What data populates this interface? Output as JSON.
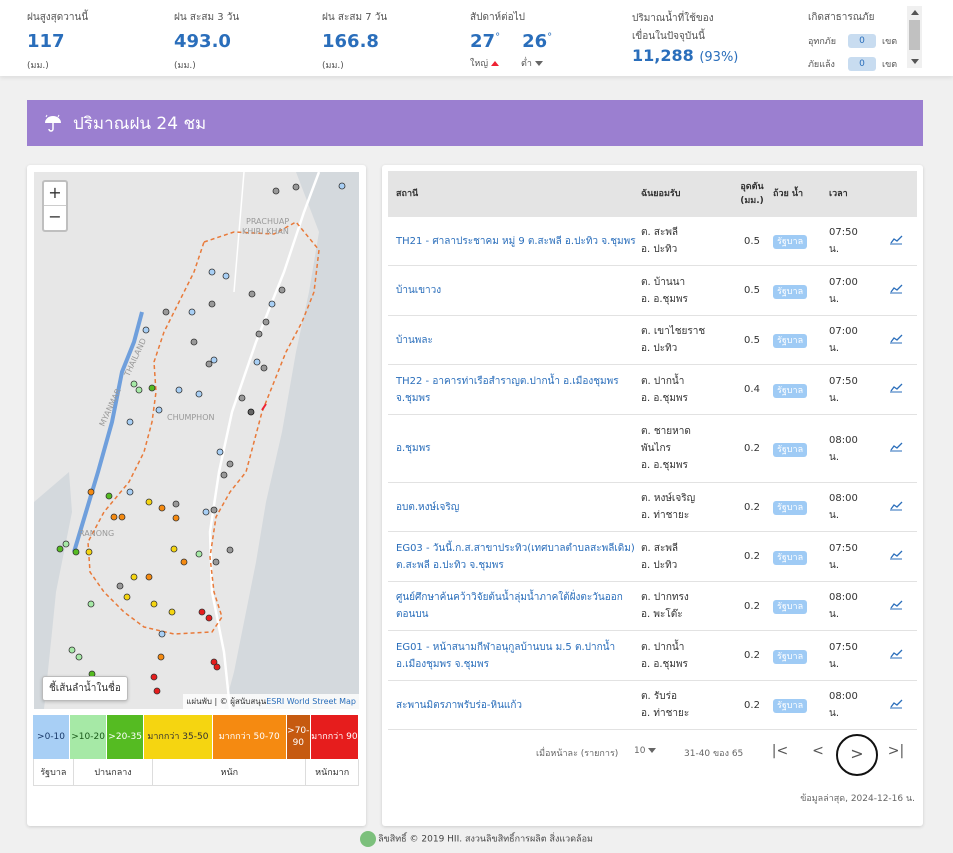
{
  "stats": {
    "max_today": {
      "label": "ฝนสูงสุดวานนี้",
      "value": "117",
      "unit": "(มม.)"
    },
    "acc_3day": {
      "label": "ฝน สะสม 3 วัน",
      "value": "493.0",
      "unit": "(มม.)"
    },
    "acc_7day": {
      "label": "ฝน สะสม 7 วัน",
      "value": "166.8",
      "unit": "(มม.)"
    },
    "temperature": {
      "label": "สัปดาห์ต่อไป",
      "high": "27",
      "low": "26",
      "high_label": "ใหญ่",
      "low_label": "ต่ำ"
    },
    "dam": {
      "label1": "ปริมาณน้ำที่ใช้ของ",
      "label2": "เขื่อนในปัจจุบันนี้",
      "value": "11,288",
      "pct": "(93%)"
    },
    "disaster": {
      "label": "เกิดสาธารณภัย",
      "flood_label": "อุทกภัย",
      "flood_value": "0",
      "drought_label": "ภัยแล้ง",
      "drought_value": "0",
      "unit": "เขต"
    }
  },
  "section_title": "ปริมาณฝน 24 ชม",
  "map": {
    "zoom_in": "+",
    "zoom_out": "−",
    "river_button": "ชี้เส้นลำน้ำในชื่อ",
    "attribution_prefix": "แผ่นพับ | © ผู้สนับสนุน",
    "attribution_link": "ESRI World Street Map",
    "labels": {
      "prachuap": "PRACHUAP",
      "khiri_khan": "KHIRI KHAN",
      "myanmar": "MYANMAR",
      "thailand": "THAILAND",
      "chumphon": "CHUMPHON",
      "ranong": "RANONG"
    }
  },
  "legend": {
    "bins": [
      {
        "label": ">0-10",
        "color": "#a8cff5",
        "text_color": "#1a3a6a"
      },
      {
        "label": ">10-20",
        "color": "#a6e9a6",
        "text_color": "#1a5a1a"
      },
      {
        "label": ">20-35",
        "color": "#55bb22",
        "text_color": "#ffffff"
      },
      {
        "label": "มากกว่า 35-50",
        "color": "#f5d511",
        "text_color": "#333333"
      },
      {
        "label": "มากกว่า 50-70",
        "color": "#f58a11",
        "text_color": "#ffffff"
      },
      {
        "label": ">70-90",
        "color": "#c65a10",
        "text_color": "#ffffff"
      },
      {
        "label": "มากกว่า 90",
        "color": "#e61d1d",
        "text_color": "#ffffff"
      }
    ],
    "categories": [
      "รัฐบาล",
      "ปานกลาง",
      "หนัก",
      "หนักมาก"
    ]
  },
  "table": {
    "headers": {
      "station": "สถานี",
      "area": "ฉันยอมรับ",
      "rain": "อุดตัน (มม.)",
      "agency": "ถ้วย น้ำ",
      "time": "เวลา"
    },
    "rows": [
      {
        "station": "TH21 - ศาลาประชาคม หมู่ 9 ต.สะพลี อ.ปะทิว จ.ชุมพร",
        "area1": "ต. สะพลี",
        "area2": "อ. ปะทิว",
        "rain": "0.5",
        "agency": "รัฐบาล",
        "time1": "07:50",
        "time2": "น."
      },
      {
        "station": "บ้านเขาวง",
        "area1": "ต. บ้านนา",
        "area2": "อ. อ.ชุมพร",
        "rain": "0.5",
        "agency": "รัฐบาล",
        "time1": "07:00",
        "time2": "น."
      },
      {
        "station": "บ้านพละ",
        "area1": "ต. เขาไชยราช",
        "area2": "อ. ปะทิว",
        "rain": "0.5",
        "agency": "รัฐบาล",
        "time1": "07:00",
        "time2": "น."
      },
      {
        "station": "TH22 - อาคารท่าเรือสำราญต.ปากน้ำ อ.เมืองชุมพร จ.ชุมพร",
        "area1": "ต. ปากน้ำ",
        "area2": "อ. อ.ชุมพร",
        "rain": "0.4",
        "agency": "รัฐบาล",
        "time1": "07:50",
        "time2": "น."
      },
      {
        "station": "อ.ชุมพร",
        "area1": "ต. ชายหาด",
        "area2": "พันไกร",
        "area3": "อ. อ.ชุมพร",
        "rain": "0.2",
        "agency": "รัฐบาล",
        "time1": "08:00",
        "time2": "น."
      },
      {
        "station": "อบต.หงษ์เจริญ",
        "area1": "ต. หงษ์เจริญ",
        "area2": "อ. ท่าชายะ",
        "rain": "0.2",
        "agency": "รัฐบาล",
        "time1": "08:00",
        "time2": "น."
      },
      {
        "station": "EG03 - วันนี้.ก.ส.สาขาประทิว(เทศบาลตำบลสะพลีเดิม) ต.สะพลี อ.ปะทิว จ.ชุมพร",
        "area1": "ต. สะพลี",
        "area2": "อ. ปะทิว",
        "rain": "0.2",
        "agency": "รัฐบาล",
        "time1": "07:50",
        "time2": "น."
      },
      {
        "station": "ศูนย์ศึกษาค้นคว้าวิจัยต้นน้ำลุ่มน้ำภาคใต้ฝั่งตะวันออกตอนบน",
        "area1": "ต. ปากทรง",
        "area2": "อ. พะโต๊ะ",
        "rain": "0.2",
        "agency": "รัฐบาล",
        "time1": "08:00",
        "time2": "น."
      },
      {
        "station": "EG01 - หน้าสนามกีฬาอนุกูลบ้านบน ม.5 ต.ปากน้ำ อ.เมืองชุมพร จ.ชุมพร",
        "area1": "ต. ปากน้ำ",
        "area2": "อ. อ.ชุมพร",
        "rain": "0.2",
        "agency": "รัฐบาล",
        "time1": "07:50",
        "time2": "น."
      },
      {
        "station": "สะพานมิตรภาพรับร่อ-หินแก้ว",
        "area1": "ต. รับร่อ",
        "area2": "อ. ท่าชายะ",
        "rain": "0.2",
        "agency": "รัฐบาล",
        "time1": "08:00",
        "time2": "น."
      }
    ],
    "pager": {
      "per_page_label": "เมื่อหน้าละ (รายการ)",
      "per_page": "10",
      "range": "31-40 ของ 65"
    },
    "updated": "ข้อมูลล่าสุด, 2024-12-16 น."
  },
  "footer": "ลิขสิทธิ์ © 2019 HII. สงวนลิขสิทธิ์การผลิต สิ่งแวดล้อม"
}
